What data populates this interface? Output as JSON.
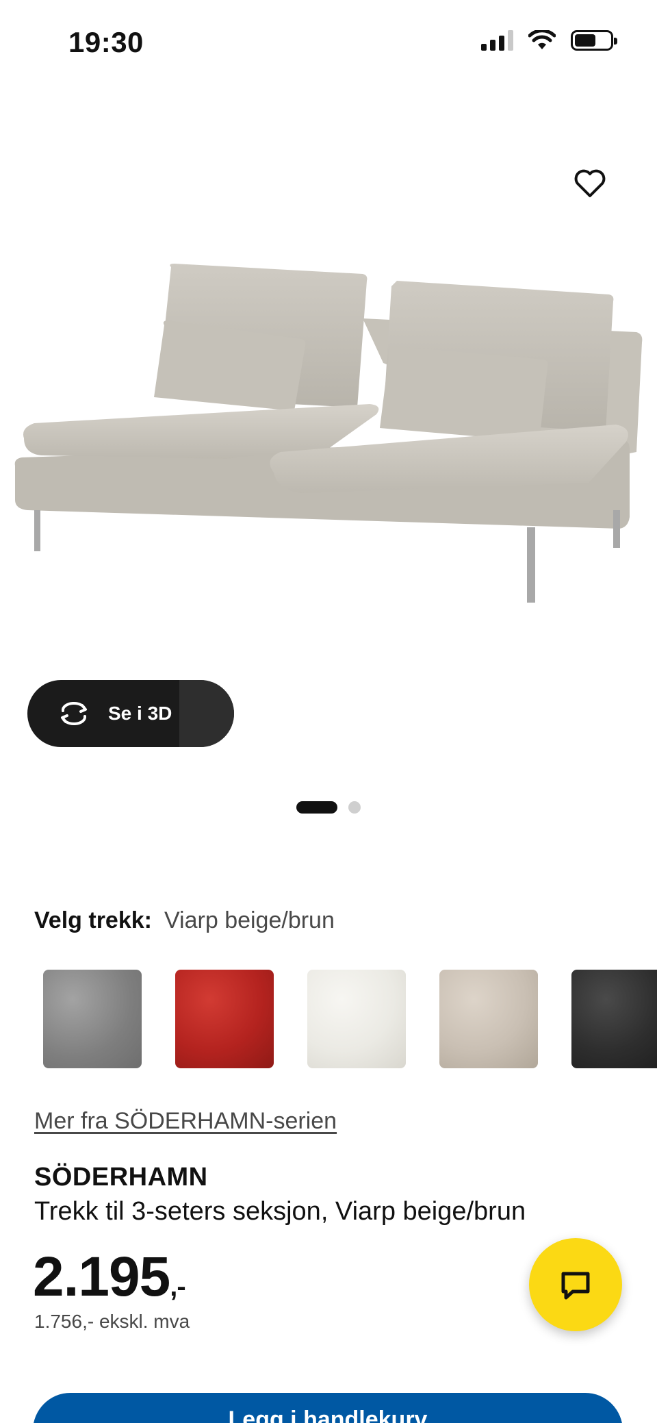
{
  "status_bar": {
    "time": "19:30",
    "icons": [
      "signal-icon",
      "wifi-icon",
      "battery-icon"
    ]
  },
  "product_gallery": {
    "image_subject": "sofa-image",
    "favorite_icon": "heart-outline-icon",
    "view_3d_label": "Se i 3D",
    "view_3d_icon": "rotate-3d-icon",
    "slide_count": 2,
    "active_slide": 1
  },
  "cover_selector": {
    "label": "Velg trekk:",
    "selected_value": "Viarp beige/brun",
    "swatch_names": [
      "grey-swatch",
      "red-swatch",
      "white-swatch",
      "beige-swatch",
      "black-swatch"
    ],
    "swatch_colors": [
      "#8a8a8a",
      "#b4231f",
      "#ecebe6",
      "#c9bfb3",
      "#2e2e2e"
    ]
  },
  "series_link": "Mer fra SÖDERHAMN-serien",
  "product": {
    "name": "SÖDERHAMN",
    "description": "Trekk til 3-seters seksjon, Viarp beige/brun",
    "price_main": "2.195",
    "price_suffix": ",-",
    "price_ex_vat": "1.756,- ekskl. mva"
  },
  "chat_button": {
    "icon": "chat-bubble-icon",
    "color": "#fbd914"
  },
  "cart_button": {
    "label": "Legg i handlekurv",
    "color": "#0058a3"
  }
}
